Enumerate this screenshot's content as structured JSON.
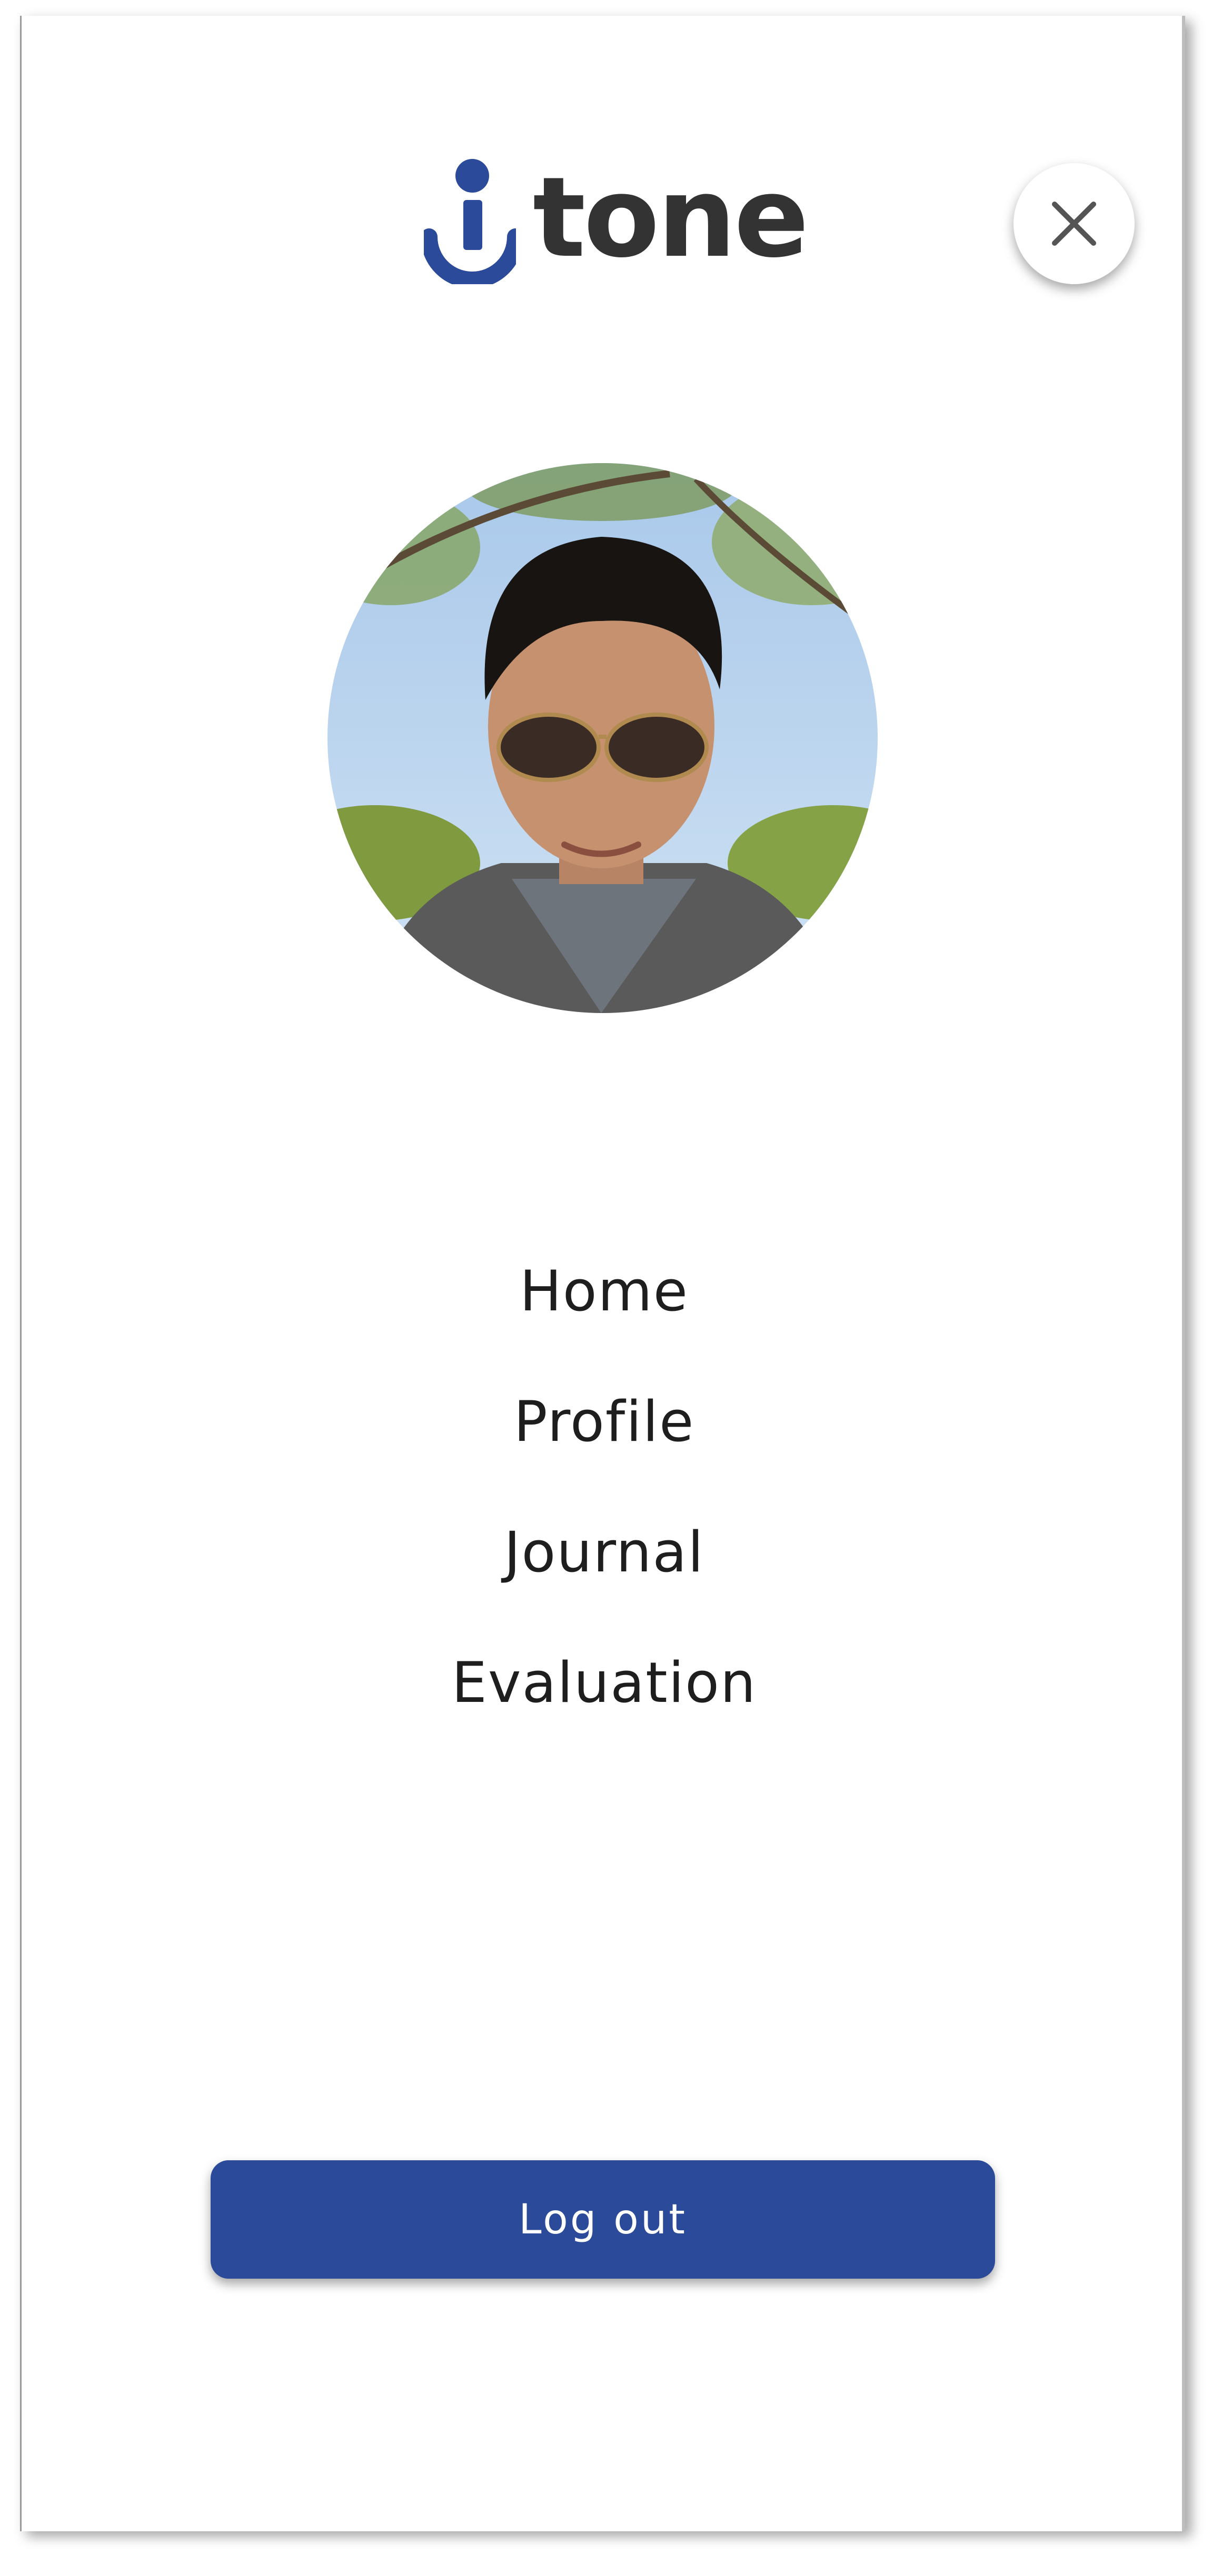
{
  "app": {
    "brand_name": "tone",
    "brand_color": "#2c4a9a",
    "logo_icon": "anchor-i-icon"
  },
  "header": {
    "close_icon": "close-icon"
  },
  "profile": {
    "avatar": "user-avatar-photo"
  },
  "nav": {
    "items": [
      {
        "label": "Home"
      },
      {
        "label": "Profile"
      },
      {
        "label": "Journal"
      },
      {
        "label": "Evaluation"
      }
    ]
  },
  "footer": {
    "logout_label": "Log out"
  }
}
